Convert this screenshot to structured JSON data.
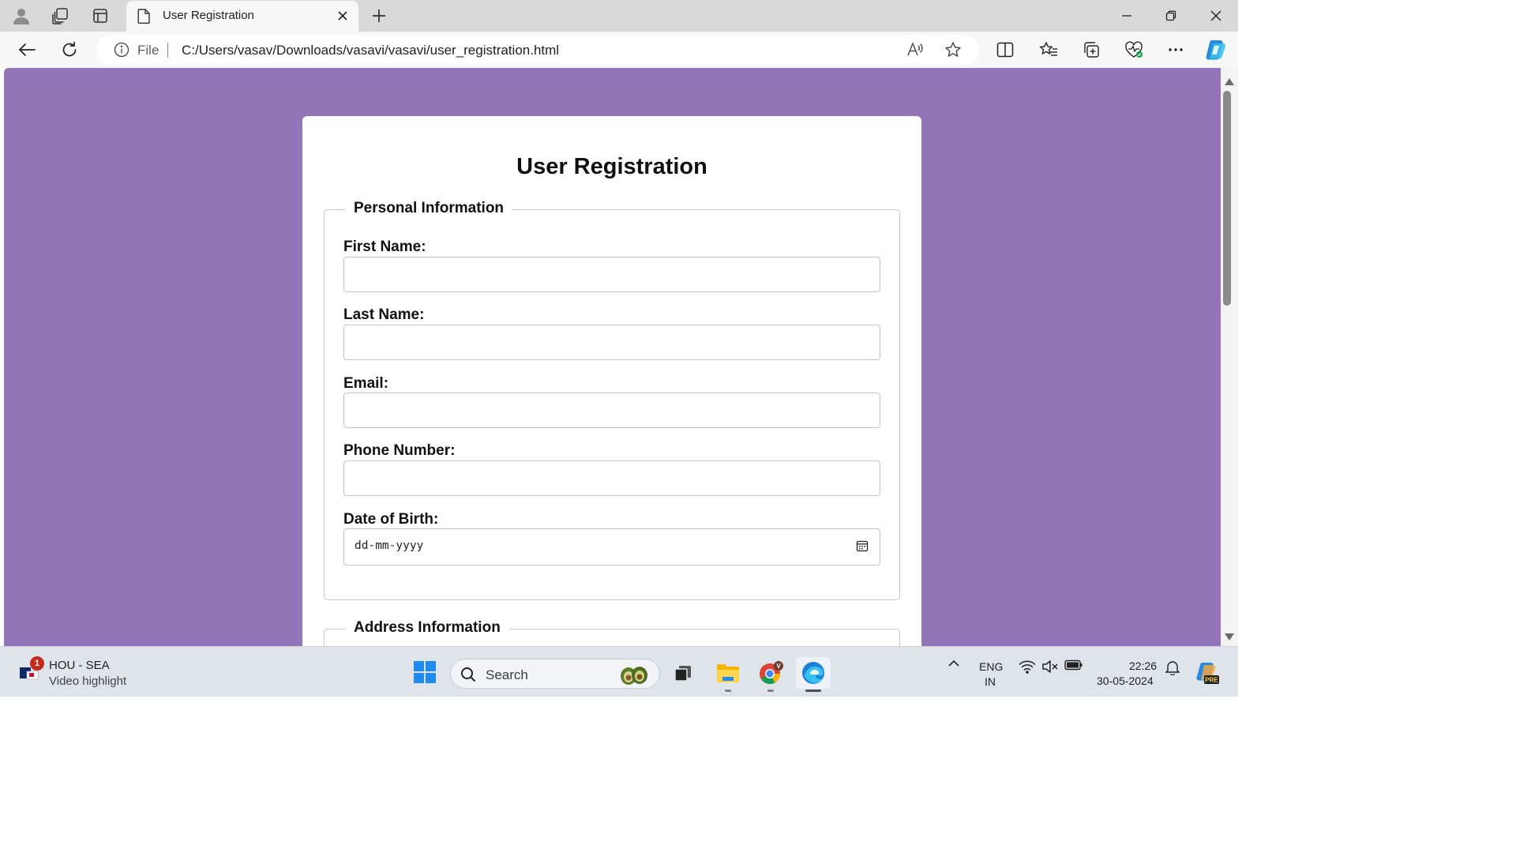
{
  "browser": {
    "tab_title": "User Registration",
    "address": {
      "scheme_label": "File",
      "url": "C:/Users/vasav/Downloads/vasavi/vasavi/user_registration.html"
    }
  },
  "page": {
    "title": "User Registration",
    "background_color": "#9575b9",
    "personal_section": {
      "legend": "Personal Information",
      "fields": [
        {
          "label": "First Name:",
          "value": ""
        },
        {
          "label": "Last Name:",
          "value": ""
        },
        {
          "label": "Email:",
          "value": ""
        },
        {
          "label": "Phone Number:",
          "value": ""
        },
        {
          "label": "Date of Birth:",
          "placeholder": "dd-mm-yyyy"
        }
      ]
    },
    "address_section": {
      "legend": "Address Information"
    }
  },
  "taskbar": {
    "news_badge": "1",
    "news_title": "HOU - SEA",
    "news_subtitle": "Video highlight",
    "search_label": "Search",
    "language_top": "ENG",
    "language_bottom": "IN",
    "time": "22:26",
    "date": "30-05-2024",
    "copilot_badge": "PRE"
  },
  "icons": [
    "profile-icon",
    "workspaces-icon",
    "tab-actions-icon",
    "document-icon",
    "close-icon",
    "new-tab-icon",
    "minimize-icon",
    "restore-icon",
    "back-icon",
    "refresh-icon",
    "info-icon",
    "read-aloud-icon",
    "favorite-star-icon",
    "split-screen-icon",
    "favorites-icon",
    "collections-icon",
    "browser-essentials-icon",
    "more-icon",
    "copilot-icon",
    "calendar-icon",
    "windows-start-icon",
    "search-icon",
    "task-view-icon",
    "file-explorer-icon",
    "chrome-icon",
    "edge-icon",
    "chevron-up-icon",
    "wifi-icon",
    "speaker-muted-icon",
    "battery-icon",
    "notification-bell-icon"
  ]
}
